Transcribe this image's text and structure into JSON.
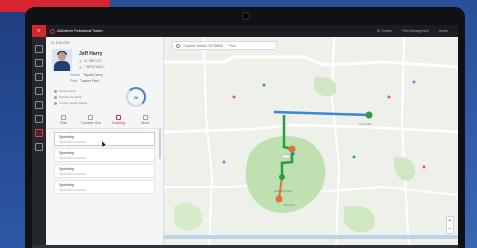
{
  "window": {
    "title": "AI&Internet Professional Tracker",
    "menu": [
      "ID: Tracker",
      "Fleet Management",
      "Admin"
    ]
  },
  "panel": {
    "header": "ID DRIVER",
    "driver": {
      "name": "Jeff Harry",
      "line1": "ID: 8857192",
      "line2": "+ 8876793812"
    },
    "details": [
      {
        "label": "Vehicle",
        "value": "Toyota Camry"
      },
      {
        "label": "Plate",
        "value": "Tracker Fleet"
      }
    ],
    "status": [
      "Performance",
      "Vehicle Condition",
      "Current Route Status"
    ],
    "gauge_value": "98",
    "tabs": [
      "Plan",
      "Transfer Hub",
      "Tracking",
      "More"
    ],
    "active_tab": "Tracking",
    "activity": [
      {
        "title": "Speeding",
        "sub": "Speed limit exceeded"
      },
      {
        "title": "Speeding",
        "sub": "Speed limit exceeded"
      },
      {
        "title": "Speeding",
        "sub": "Speed limit exceeded"
      },
      {
        "title": "Speeding",
        "sub": "Speed limit exceeded"
      }
    ]
  },
  "map": {
    "search": "Trucked Vehicle 33735658",
    "search_action": "Plan",
    "zoom_in": "+",
    "zoom_out": "−",
    "labels": [
      "Garfield Park",
      "Orchard",
      "Crest Hill"
    ],
    "colors": {
      "route": "#3b86d6",
      "alt_route": "#e0733a",
      "green": "#2a9b46"
    }
  }
}
